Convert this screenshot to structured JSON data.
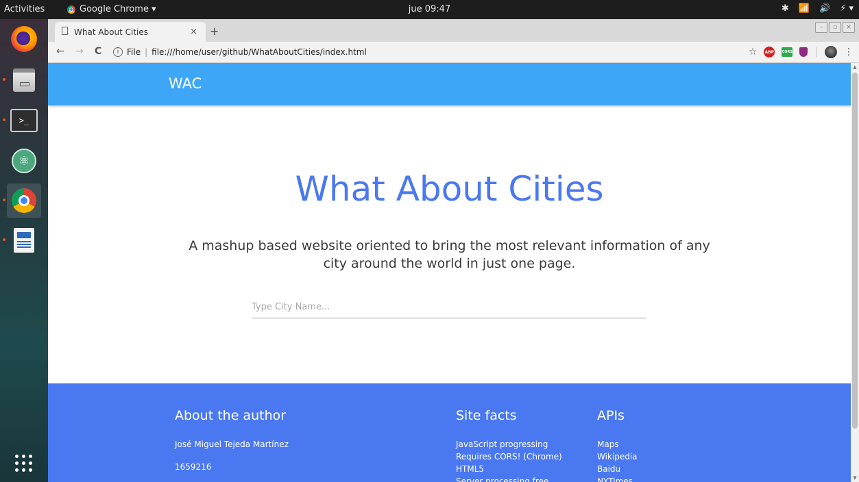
{
  "system": {
    "activities": "Activities",
    "app_name": "Google Chrome ▾",
    "clock": "jue 09:47",
    "tray": [
      "✱",
      "📶",
      "🔊",
      "⚡ ▾"
    ]
  },
  "browser": {
    "tab_title": "What About Cities",
    "tab_close": "×",
    "new_tab": "+",
    "back": "←",
    "forward": "→",
    "reload": "C",
    "info": "i",
    "scheme_label": "File",
    "url": "file:///home/user/github/WhatAboutCities/index.html",
    "bookmark_star": "☆",
    "abp": "ABP",
    "cors": "CORS",
    "menu": "⋮"
  },
  "page": {
    "brand": "WAC",
    "title": "What About Cities",
    "subtitle_line1": "A mashup based website oriented to bring the most relevant information of any",
    "subtitle_line2": "city around the world in just one page.",
    "search_placeholder": "Type City Name...",
    "footer": {
      "about": {
        "heading": "About the author",
        "name": "José Miguel Tejeda Martínez",
        "id": "1659216"
      },
      "facts": {
        "heading": "Site facts",
        "items": [
          "JavaScript progressing",
          "Requires CORS! (Chrome)",
          "HTML5",
          "Server processing free"
        ]
      },
      "apis": {
        "heading": "APIs",
        "items": [
          "Maps",
          "Wikipedia",
          "Baidu",
          "NYTimes"
        ]
      }
    },
    "colors": {
      "navbar": "#3ea6f7",
      "accent": "#4a78f0",
      "warning": "#ff2b2b"
    }
  }
}
